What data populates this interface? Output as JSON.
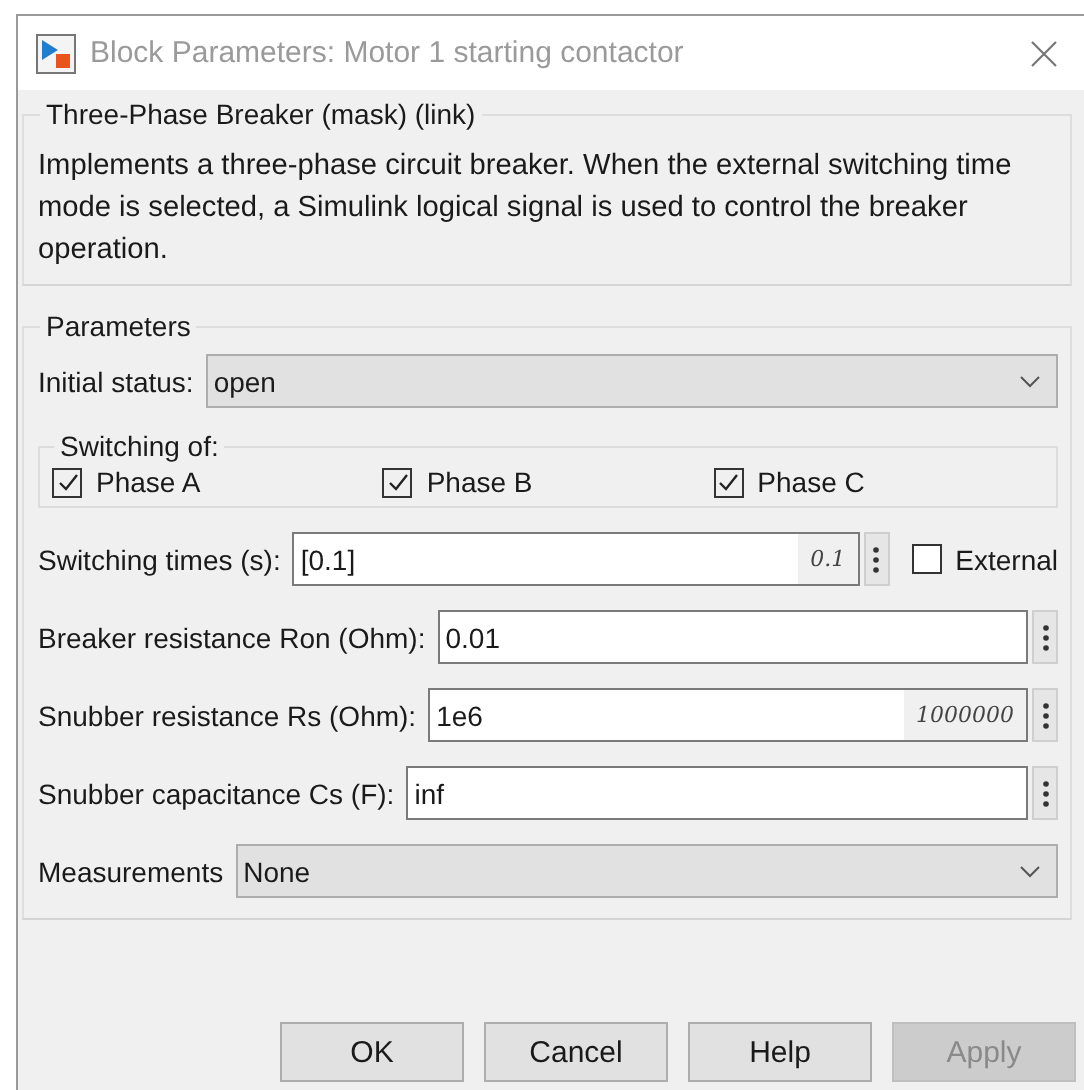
{
  "window": {
    "title": "Block Parameters: Motor 1 starting contactor"
  },
  "mask_group": {
    "title": "Three-Phase Breaker (mask) (link)",
    "description": "Implements a three-phase circuit breaker. When the external switching time mode is selected, a Simulink logical signal is used to control the breaker operation."
  },
  "parameters": {
    "title": "Parameters",
    "rows": [
      {
        "kind": "dropdown",
        "label": "Initial status:",
        "value": "open"
      },
      {
        "kind": "checkgroup",
        "title": "Switching of:",
        "items": [
          {
            "label": "Phase A",
            "checked": true
          },
          {
            "label": "Phase B",
            "checked": true
          },
          {
            "label": "Phase C",
            "checked": true
          }
        ]
      },
      {
        "kind": "edit",
        "label": "Switching times (s):",
        "value": "[0.1]",
        "evaluated": "0.1",
        "external": {
          "label": "External",
          "checked": false
        }
      },
      {
        "kind": "edit",
        "label": "Breaker resistance Ron (Ohm):",
        "value": "0.01"
      },
      {
        "kind": "edit",
        "label": "Snubber resistance Rs (Ohm):",
        "value": "1e6",
        "evaluated": "1000000"
      },
      {
        "kind": "edit",
        "label": "Snubber capacitance Cs (F):",
        "value": "inf"
      },
      {
        "kind": "dropdown",
        "label": "Measurements",
        "value": "None"
      }
    ]
  },
  "buttons": [
    {
      "label": "OK",
      "disabled": false
    },
    {
      "label": "Cancel",
      "disabled": false
    },
    {
      "label": "Help",
      "disabled": false
    },
    {
      "label": "Apply",
      "disabled": true
    }
  ]
}
